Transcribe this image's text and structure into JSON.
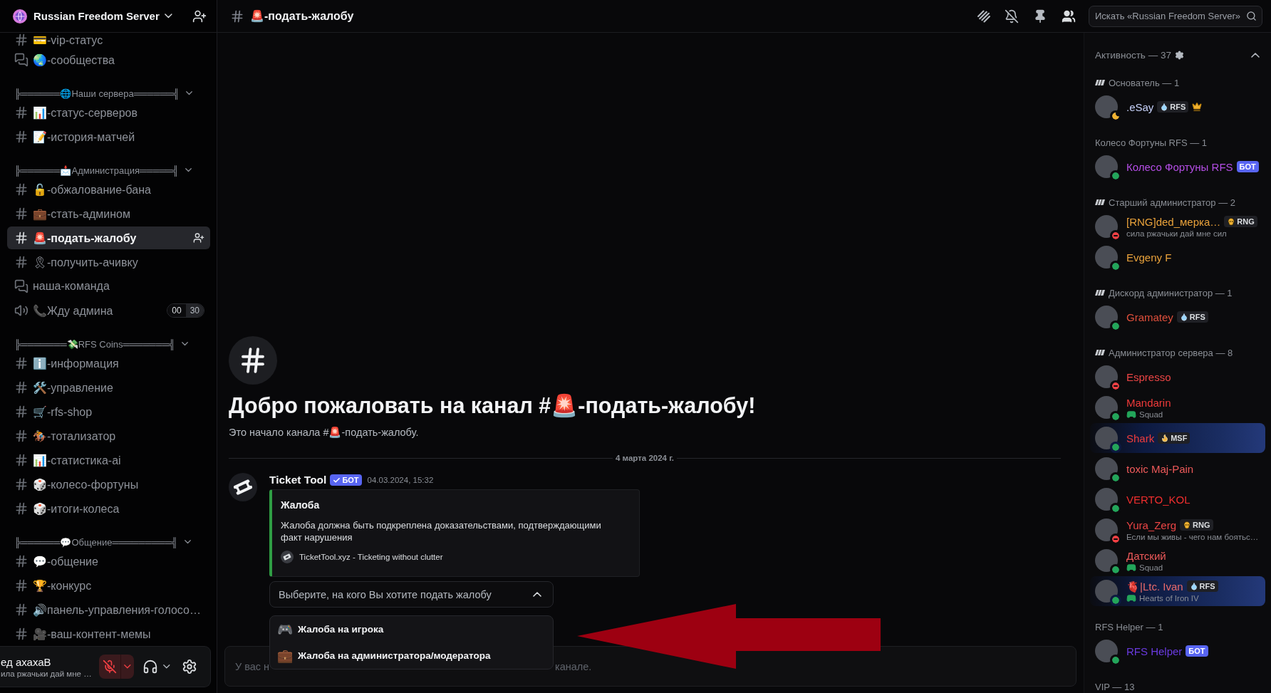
{
  "server": {
    "name": "Russian Freedom Server"
  },
  "sidebar": {
    "channels": [
      {
        "kind": "text",
        "name": "💳-vip-статус",
        "selected": false
      },
      {
        "kind": "forum",
        "name": "🌏-сообщества",
        "selected": false
      }
    ],
    "categories": [
      {
        "name": "╠══════🌐Наши сервера══════╣",
        "expanded": true,
        "channels": [
          {
            "kind": "text",
            "name": "📊-статус-серверов",
            "selected": false
          },
          {
            "kind": "text",
            "name": "📝-история-матчей",
            "selected": false
          }
        ]
      },
      {
        "name": "╠══════📩Администрация═════╣",
        "expanded": true,
        "channels": [
          {
            "kind": "text",
            "name": "🔓-обжалование-бана",
            "selected": false
          },
          {
            "kind": "text",
            "name": "💼-стать-админом",
            "selected": false
          },
          {
            "kind": "text",
            "name": "🚨-подать-жалобу",
            "selected": true
          },
          {
            "kind": "text",
            "name": "🎗-получить-ачивку",
            "selected": false
          },
          {
            "kind": "forum",
            "name": "наша-команда",
            "selected": false
          },
          {
            "kind": "voice",
            "name": "📞Жду админа",
            "selected": false,
            "user_count": "00",
            "user_limit": "30"
          }
        ]
      },
      {
        "name": "╠═══════💸RFS Coins═══════╣",
        "expanded": true,
        "channels": [
          {
            "kind": "text",
            "name": "ℹ️-информация",
            "selected": false
          },
          {
            "kind": "text",
            "name": "🛠️-управление",
            "selected": false
          },
          {
            "kind": "text",
            "name": "🛒-rfs-shop",
            "selected": false
          },
          {
            "kind": "text",
            "name": "🏇-тотализатор",
            "selected": false
          },
          {
            "kind": "text",
            "name": "📊-статистика-ai",
            "selected": false
          },
          {
            "kind": "text",
            "name": "🎲-колесо-фортуны",
            "selected": false
          },
          {
            "kind": "text",
            "name": "🎲-итоги-колеса",
            "selected": false
          }
        ]
      },
      {
        "name": "╠══════💬Общение═════════╣",
        "expanded": true,
        "channels": [
          {
            "kind": "text",
            "name": "💬-общение",
            "selected": false
          },
          {
            "kind": "text",
            "name": "🏆-конкурс",
            "selected": false
          },
          {
            "kind": "text",
            "name": "🔊панель-управления-голосо…",
            "selected": false
          },
          {
            "kind": "text",
            "name": "🎥-ваш-контент-мемы",
            "selected": false
          }
        ]
      }
    ]
  },
  "user_panel": {
    "name": "ед ахахаВ",
    "status": "ила ржачьки дай мне …",
    "mic_muted": true
  },
  "channel_header": {
    "name": "🚨-подать-жалобу",
    "search": {
      "placeholder": "Искать «Russian Freedom Server»"
    }
  },
  "welcome": {
    "title": "Добро пожаловать на канал #🚨-подать-жалобу!",
    "subtitle": "Это начало канала #🚨-подать-жалобу."
  },
  "date_divider": "4 марта 2024 г.",
  "message": {
    "author": "Ticket Tool",
    "bot_tag": "БОТ",
    "verified": true,
    "time": "04.03.2024, 15:32",
    "embed": {
      "title": "Жалоба",
      "description": "Жалоба должна быть подкреплена доказательствами, подтверждающими факт нарушения",
      "footer": "TicketTool.xyz - Ticketing without clutter"
    },
    "select": {
      "placeholder": "Выберите, на кого Вы хотите подать жалобу",
      "expanded": true,
      "options": [
        {
          "emoji": "🎮",
          "label": "Жалоба на игрока"
        },
        {
          "emoji": "💼",
          "label": "Жалоба на администратора/модератора"
        }
      ]
    }
  },
  "composer": {
    "placeholder_fragments": [
      "У вас н",
      "канале."
    ]
  },
  "members": {
    "header": "Активность — 37",
    "expanded": true,
    "groups": [
      {
        "title": "Основатель — 1",
        "role_icon": true,
        "members": [
          {
            "name": ".eSay",
            "color": "#c7d2fb",
            "presence": {
              "kind": "idle"
            },
            "tag": {
              "kind": "drop",
              "label": "RFS"
            },
            "owner": true,
            "nameplate": false
          }
        ]
      },
      {
        "title": "Колесо Фортуны RFS — 1",
        "role_icon": false,
        "members": [
          {
            "name": "Колесо Фортуны RFS",
            "color": "#b54ee6",
            "presence": {
              "kind": "online"
            },
            "bot_tag": "БОТ",
            "owner": false,
            "nameplate": false
          }
        ]
      },
      {
        "title": "Старший администратор — 2",
        "role_icon": true,
        "members": [
          {
            "name": "[RNG]ded_мерка…",
            "color": "#e9a23b",
            "presence": {
              "kind": "dnd"
            },
            "tag": {
              "kind": "skull",
              "label": "RNG"
            },
            "activity": {
              "kind": "custom",
              "text": "сила ржачьки дай мне сил"
            },
            "owner": false,
            "nameplate": false
          },
          {
            "name": "Evgeny F",
            "color": "#e9a23b",
            "presence": {
              "kind": "online"
            },
            "owner": false,
            "nameplate": false
          }
        ]
      },
      {
        "title": "Дискорд администратор — 1",
        "role_icon": true,
        "members": [
          {
            "name": "Gramatey",
            "color": "#e0503c",
            "presence": {
              "kind": "online"
            },
            "tag": {
              "kind": "drop",
              "label": "RFS"
            },
            "owner": false,
            "nameplate": false
          }
        ]
      },
      {
        "title": "Администратор сервера — 8",
        "role_icon": true,
        "members": [
          {
            "name": "Espresso",
            "color": "#ec4545",
            "presence": {
              "kind": "dnd"
            },
            "owner": false,
            "nameplate": false
          },
          {
            "name": "Mandarin",
            "color": "#f03a3a",
            "presence": {
              "kind": "online"
            },
            "activity": {
              "kind": "game",
              "text": "Squad"
            },
            "owner": false,
            "nameplate": false
          },
          {
            "name": "Shark",
            "color": "#f03c3c",
            "presence": {
              "kind": "online"
            },
            "tag": {
              "kind": "fire",
              "label": "MSF"
            },
            "owner": false,
            "nameplate": true
          },
          {
            "name": "toxic Maj-Pain",
            "color": "#ee5a5a",
            "presence": {
              "kind": "online"
            },
            "owner": false,
            "nameplate": false
          },
          {
            "name": "VERTO_KOL",
            "color": "#f02e2e",
            "presence": {
              "kind": "online"
            },
            "owner": false,
            "nameplate": false
          },
          {
            "name": "Yura_Zerg",
            "color": "#ec4545",
            "presence": {
              "kind": "dnd"
            },
            "tag": {
              "kind": "skull",
              "label": "RNG"
            },
            "activity": {
              "kind": "custom",
              "text": "Если мы живы - чего нам боятьс…"
            },
            "owner": false,
            "nameplate": false
          },
          {
            "name": "Датский",
            "color": "#ee5a5a",
            "presence": {
              "kind": "online"
            },
            "activity": {
              "kind": "game",
              "text": "Squad"
            },
            "owner": false,
            "nameplate": false
          },
          {
            "name": "🫀|Ltc. Ivan",
            "color": "#e86a6a",
            "presence": {
              "kind": "online"
            },
            "tag": {
              "kind": "drop",
              "label": "RFS"
            },
            "activity": {
              "kind": "game",
              "text": "Hearts of Iron IV"
            },
            "owner": false,
            "nameplate": true
          }
        ]
      },
      {
        "title": "RFS Helper — 1",
        "role_icon": false,
        "members": [
          {
            "name": "RFS Helper",
            "color": "#6a3ae0",
            "presence": {
              "kind": "online"
            },
            "bot_tag": "БОТ",
            "owner": false,
            "nameplate": false
          }
        ]
      },
      {
        "title": "VIP — 13",
        "role_icon": false
      }
    ]
  }
}
